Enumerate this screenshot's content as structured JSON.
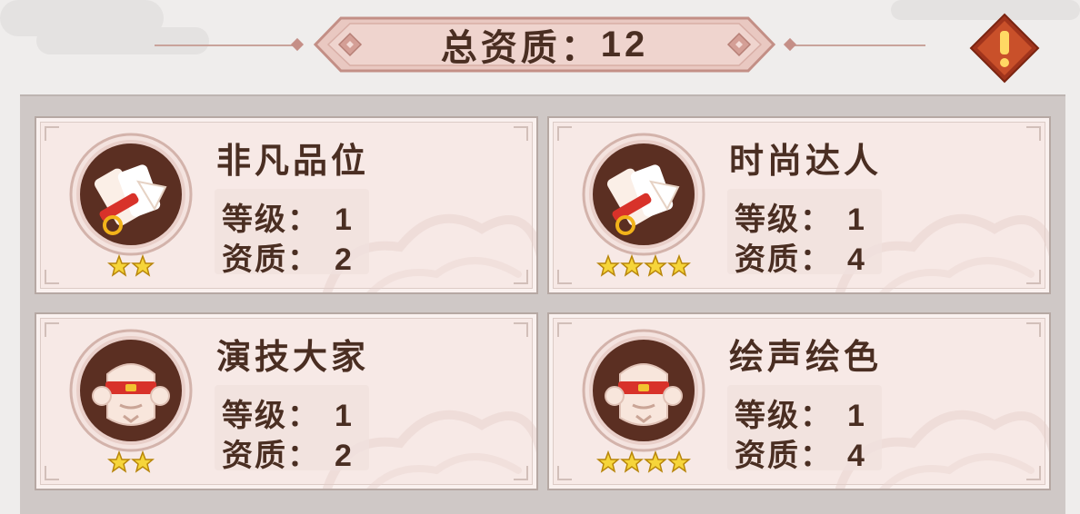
{
  "header": {
    "label": "总资质：",
    "value": "12"
  },
  "warning_icon": "exclamation-icon",
  "colors": {
    "banner": "#e6c3bd",
    "card_bg": "#f7e9e6",
    "text": "#4a2e22",
    "icon_ring": "#5b2f22",
    "star": "#f6d53a"
  },
  "cards": [
    {
      "name": "非凡品位",
      "level_label": "等级：",
      "level": "1",
      "quality_label": "资质：",
      "quality": "2",
      "stars": 2,
      "icon": "scroll-icon"
    },
    {
      "name": "时尚达人",
      "level_label": "等级：",
      "level": "1",
      "quality_label": "资质：",
      "quality": "4",
      "stars": 4,
      "icon": "scroll-icon"
    },
    {
      "name": "演技大家",
      "level_label": "等级：",
      "level": "1",
      "quality_label": "资质：",
      "quality": "2",
      "stars": 2,
      "icon": "opera-mask-icon"
    },
    {
      "name": "绘声绘色",
      "level_label": "等级：",
      "level": "1",
      "quality_label": "资质：",
      "quality": "4",
      "stars": 4,
      "icon": "opera-mask-icon"
    }
  ]
}
